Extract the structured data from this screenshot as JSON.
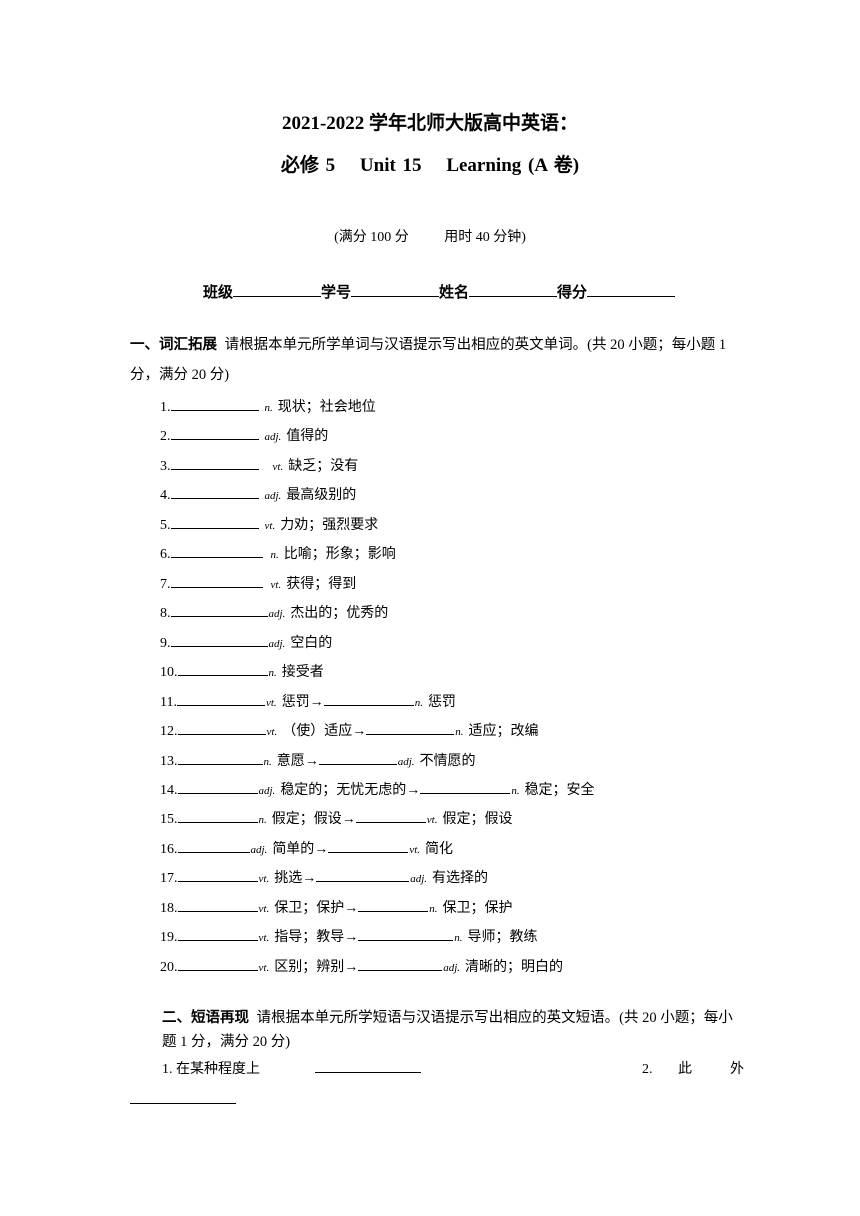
{
  "document": {
    "title_line1": "2021-2022 学年北师大版高中英语：",
    "title_line2": [
      "必修 5",
      "Unit 15",
      "Learning (A 卷)"
    ],
    "meta": {
      "score": "(满分 100 分",
      "time": "用时 40 分钟)"
    },
    "info_fields": [
      "班级",
      "学号",
      "姓名",
      "得分"
    ]
  },
  "section1": {
    "heading": "一、词汇拓展",
    "instruction": "请根据本单元所学单词与汉语提示写出相应的英文单词。(共 20 小题；每小题 1 分，满分 20 分)",
    "items": [
      {
        "num": "1.",
        "pos": "n.",
        "meaning": "现状；社会地位"
      },
      {
        "num": "2.",
        "pos": "adj.",
        "meaning": "值得的"
      },
      {
        "num": "3.",
        "pos": "vt.",
        "meaning": "缺乏；没有"
      },
      {
        "num": "4.",
        "pos": "adj.",
        "meaning": "最高级别的"
      },
      {
        "num": "5.",
        "pos": "vt.",
        "meaning": "力劝；强烈要求"
      },
      {
        "num": "6.",
        "pos": "n.",
        "meaning": "比喻；形象；影响"
      },
      {
        "num": "7.",
        "pos": "vt.",
        "meaning": "获得；得到"
      },
      {
        "num": "8.",
        "pos": "adj.",
        "meaning": "杰出的；优秀的"
      },
      {
        "num": "9.",
        "pos": "adj.",
        "meaning": "空白的"
      },
      {
        "num": "10.",
        "pos": "n.",
        "meaning": "接受者"
      },
      {
        "num": "11.",
        "pos": "vt.",
        "meaning": "惩罚→",
        "pos2": "n.",
        "meaning2": "惩罚"
      },
      {
        "num": "12.",
        "pos": "vt.",
        "meaning": "（使）适应→",
        "pos2": "n.",
        "meaning2": "适应；改编"
      },
      {
        "num": "13.",
        "pos": "n.",
        "meaning": "意愿→",
        "pos2": "adj.",
        "meaning2": "不情愿的"
      },
      {
        "num": "14.",
        "pos": "adj.",
        "meaning": "稳定的；无忧无虑的→",
        "pos2": "n.",
        "meaning2": "稳定；安全"
      },
      {
        "num": "15.",
        "pos": "n.",
        "meaning": "假定；假设→",
        "pos2": "vt.",
        "meaning2": "假定；假设"
      },
      {
        "num": "16.",
        "pos": "adj.",
        "meaning": "简单的→",
        "pos2": "vt.",
        "meaning2": "简化"
      },
      {
        "num": "17.",
        "pos": "vt.",
        "meaning": "挑选→",
        "pos2": "adj.",
        "meaning2": "有选择的"
      },
      {
        "num": "18.",
        "pos": "vt.",
        "meaning": "保卫；保护→",
        "pos2": "n.",
        "meaning2": "保卫；保护"
      },
      {
        "num": "19.",
        "pos": "vt.",
        "meaning": "指导；教导→",
        "pos2": "n.",
        "meaning2": "导师；教练"
      },
      {
        "num": "20.",
        "pos": "vt.",
        "meaning": "区别；辨别→",
        "pos2": "adj.",
        "meaning2": "清晰的；明白的"
      }
    ]
  },
  "section2": {
    "heading": "二、短语再现",
    "instruction": "请根据本单元所学短语与汉语提示写出相应的英文短语。(共 20 小题；每小题 1 分，满分 20 分)",
    "items": [
      {
        "num": "1.",
        "meaning": "在某种程度上"
      },
      {
        "num": "2.",
        "meaning": "此　外"
      }
    ]
  }
}
